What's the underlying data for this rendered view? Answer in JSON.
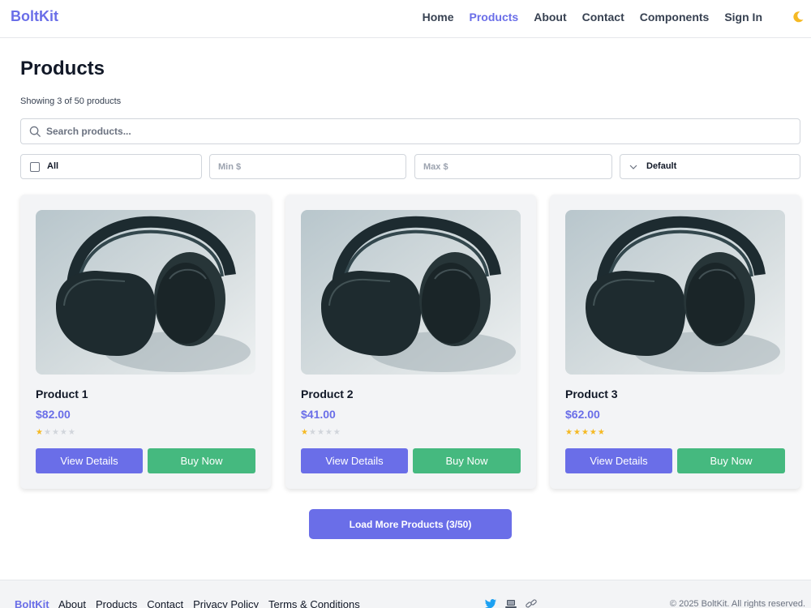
{
  "nav": {
    "brand": "BoltKit",
    "links": [
      "Home",
      "Products",
      "About",
      "Contact",
      "Components",
      "Sign In"
    ],
    "active": "Products",
    "theme_icon": "moon-icon"
  },
  "header": {
    "title": "Products",
    "count_text": "Showing 3 of 50 products"
  },
  "search": {
    "placeholder": "Search products...",
    "icon": "search-icon"
  },
  "filters": {
    "category_label": "All",
    "min_placeholder": "Min $",
    "max_placeholder": "Max $",
    "sort_label": "Default"
  },
  "products": [
    {
      "name": "Product 1",
      "price": "$82.00",
      "rating": 1,
      "view": "View Details",
      "buy": "Buy Now"
    },
    {
      "name": "Product 2",
      "price": "$41.00",
      "rating": 1,
      "view": "View Details",
      "buy": "Buy Now"
    },
    {
      "name": "Product 3",
      "price": "$62.00",
      "rating": 5,
      "view": "View Details",
      "buy": "Buy Now"
    }
  ],
  "rating_max": 5,
  "load_more": "Load More Products (3/50)",
  "footer": {
    "brand": "BoltKit",
    "links": [
      "About",
      "Products",
      "Contact",
      "Privacy Policy",
      "Terms & Conditions"
    ],
    "social_icons": [
      "twitter-bird-icon",
      "laptop-icon",
      "link-icon"
    ],
    "copyright": "© 2025 BoltKit. All rights reserved."
  },
  "colors": {
    "accent": "#6a6ee8",
    "buy": "#45b97f",
    "star_filled": "#f5b923",
    "star_empty": "#d1d5db"
  }
}
